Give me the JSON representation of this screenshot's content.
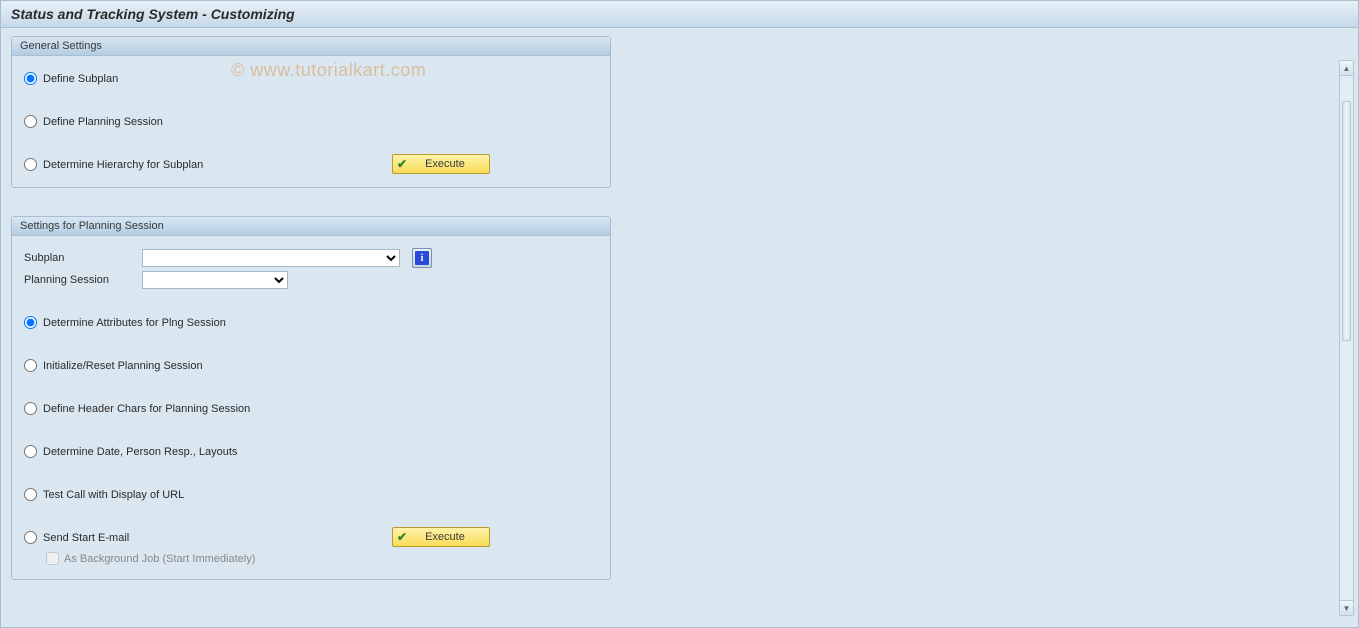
{
  "title": "Status and Tracking System - Customizing",
  "watermark": "© www.tutorialkart.com",
  "panels": {
    "general": {
      "header": "General Settings",
      "options": {
        "define_subplan": "Define Subplan",
        "define_session": "Define Planning Session",
        "determine_hierarchy": "Determine Hierarchy for Subplan"
      },
      "execute_label": "Execute"
    },
    "session": {
      "header": "Settings for Planning Session",
      "fields": {
        "subplan_label": "Subplan",
        "subplan_value": "",
        "planning_session_label": "Planning Session",
        "planning_session_value": ""
      },
      "options": {
        "determine_attrs": "Determine Attributes for Plng Session",
        "initialize_reset": "Initialize/Reset Planning Session",
        "define_header_chars": "Define Header Chars for Planning Session",
        "determine_date": "Determine Date, Person Resp., Layouts",
        "test_call": "Test Call with Display of URL",
        "send_email": "Send Start E-mail"
      },
      "checkbox_label": "As Background Job (Start Immediately)",
      "execute_label": "Execute"
    }
  },
  "info_icon_glyph": "i"
}
